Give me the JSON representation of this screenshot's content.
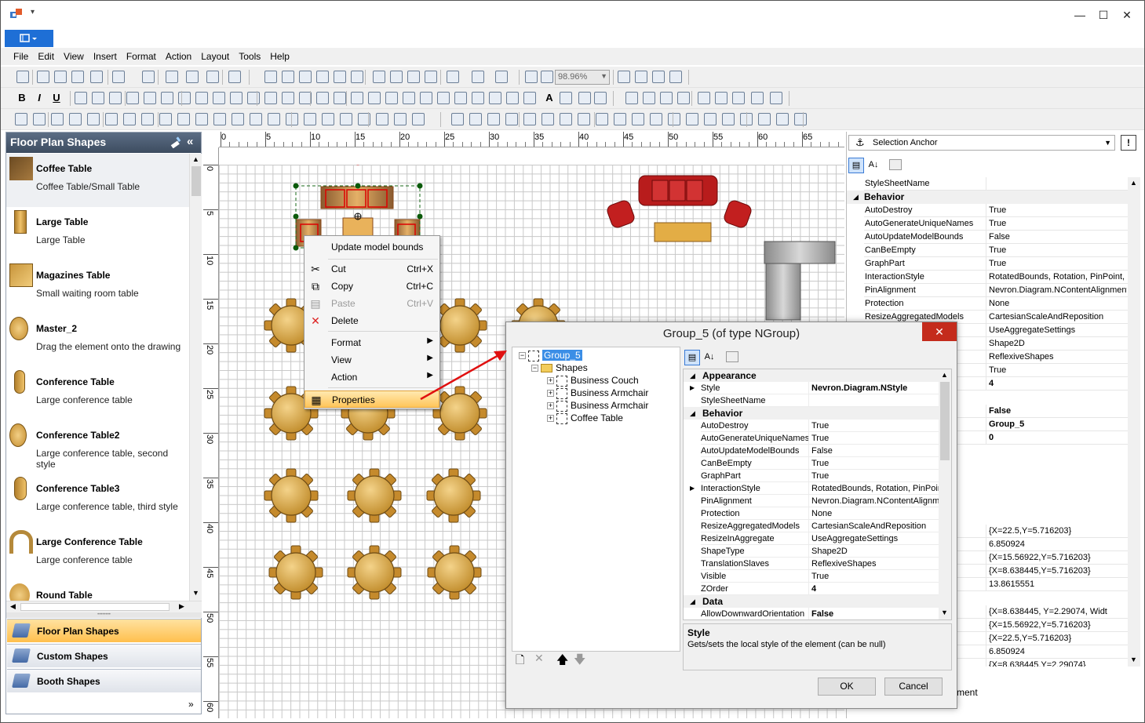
{
  "window": {
    "quick_access_glyph": "▾",
    "minimize": "—",
    "maximize": "☐",
    "close": "✕"
  },
  "menu": {
    "items": [
      "File",
      "Edit",
      "View",
      "Insert",
      "Format",
      "Action",
      "Layout",
      "Tools",
      "Help"
    ]
  },
  "toolbar": {
    "zoom": "98.96%"
  },
  "library": {
    "title": "Floor Plan Shapes",
    "items": [
      {
        "title": "Coffee Table",
        "desc": "Coffee Table/Small Table"
      },
      {
        "title": "Large Table",
        "desc": "Large Table"
      },
      {
        "title": "Magazines Table",
        "desc": "Small waiting room table"
      },
      {
        "title": "Master_2",
        "desc": "Drag the element onto the drawing"
      },
      {
        "title": "Conference Table",
        "desc": "Large conference table"
      },
      {
        "title": "Conference Table2",
        "desc": "Large conference table, second style"
      },
      {
        "title": "Conference Table3",
        "desc": "Large conference table, third style"
      },
      {
        "title": "Large Conference Table",
        "desc": "Large conference table"
      },
      {
        "title": "Round Table",
        "desc": ""
      }
    ],
    "nav": [
      "Floor Plan Shapes",
      "Custom Shapes",
      "Booth Shapes"
    ]
  },
  "rulers": {
    "h": [
      "0",
      "5",
      "10",
      "15",
      "20",
      "25",
      "30",
      "35",
      "40",
      "45",
      "50",
      "55",
      "60",
      "65"
    ],
    "v": [
      "0",
      "5",
      "10",
      "15",
      "20",
      "25",
      "30",
      "35",
      "40",
      "45",
      "50",
      "55",
      "60"
    ]
  },
  "context_menu": {
    "items": [
      {
        "label": "Update model bounds",
        "shortcut": ""
      },
      {
        "label": "Cut",
        "shortcut": "Ctrl+X"
      },
      {
        "label": "Copy",
        "shortcut": "Ctrl+C"
      },
      {
        "label": "Paste",
        "shortcut": "Ctrl+V"
      },
      {
        "label": "Delete",
        "shortcut": ""
      },
      {
        "label": "Format",
        "shortcut": ""
      },
      {
        "label": "View",
        "shortcut": ""
      },
      {
        "label": "Action",
        "shortcut": ""
      },
      {
        "label": "Properties",
        "shortcut": ""
      }
    ]
  },
  "properties": {
    "selector": "Selection Anchor",
    "rows": [
      {
        "n": "StyleSheetName",
        "v": "",
        "cat": false
      },
      {
        "n": "Behavior",
        "v": "",
        "cat": true
      },
      {
        "n": "AutoDestroy",
        "v": "True"
      },
      {
        "n": "AutoGenerateUniqueNames",
        "v": "True"
      },
      {
        "n": "AutoUpdateModelBounds",
        "v": "False"
      },
      {
        "n": "CanBeEmpty",
        "v": "True"
      },
      {
        "n": "GraphPart",
        "v": "True"
      },
      {
        "n": "InteractionStyle",
        "v": "RotatedBounds, Rotation, PinPoint, S"
      },
      {
        "n": "PinAlignment",
        "v": "Nevron.Diagram.NContentAlignment"
      },
      {
        "n": "Protection",
        "v": "None"
      },
      {
        "n": "ResizeAggregatedModels",
        "v": "CartesianScaleAndReposition"
      },
      {
        "n": "",
        "v": "UseAggregateSettings"
      },
      {
        "n": "",
        "v": "Shape2D"
      },
      {
        "n": "",
        "v": "ReflexiveShapes"
      },
      {
        "n": "",
        "v": "True"
      },
      {
        "n": "",
        "v": "4",
        "b": true
      }
    ],
    "rows2": [
      {
        "n": "on",
        "v": "False",
        "b": true
      },
      {
        "n": "",
        "v": "Group_5",
        "b": true
      },
      {
        "n": "",
        "v": "0",
        "b": true
      }
    ],
    "rows3": [
      {
        "v": "{X=22.5,Y=5.716203}"
      },
      {
        "v": "6.850924"
      },
      {
        "v": "{X=15.56922,Y=5.716203}"
      },
      {
        "v": "{X=8.638445,Y=5.716203}"
      },
      {
        "v": "13.8615551"
      }
    ],
    "rows4": [
      {
        "v": "{X=8.638445, Y=2.29074, Widt"
      },
      {
        "v": "{X=15.56922,Y=5.716203}"
      },
      {
        "v": "{X=22.5,Y=5.716203}"
      },
      {
        "v": "6.850924"
      },
      {
        "v": "{X=8.638445,Y=2.29074}"
      }
    ],
    "footer_fragment": "ment"
  },
  "dialog": {
    "title": "Group_5 (of type NGroup)",
    "close": "✕",
    "tree": {
      "root": "Group_5",
      "folder": "Shapes",
      "children": [
        "Business Couch",
        "Business Armchair",
        "Business Armchair",
        "Coffee Table"
      ]
    },
    "grid": [
      {
        "n": "Appearance",
        "cat": true
      },
      {
        "n": "Style",
        "v": "Nevron.Diagram.NStyle",
        "b": true,
        "exp": true
      },
      {
        "n": "StyleSheetName",
        "v": ""
      },
      {
        "n": "Behavior",
        "cat": true
      },
      {
        "n": "AutoDestroy",
        "v": "True"
      },
      {
        "n": "AutoGenerateUniqueNames",
        "v": "True"
      },
      {
        "n": "AutoUpdateModelBounds",
        "v": "False"
      },
      {
        "n": "CanBeEmpty",
        "v": "True"
      },
      {
        "n": "GraphPart",
        "v": "True"
      },
      {
        "n": "InteractionStyle",
        "v": "RotatedBounds, Rotation, PinPoint",
        "exp": true
      },
      {
        "n": "PinAlignment",
        "v": "Nevron.Diagram.NContentAlignment"
      },
      {
        "n": "Protection",
        "v": "None"
      },
      {
        "n": "ResizeAggregatedModels",
        "v": "CartesianScaleAndReposition"
      },
      {
        "n": "ResizeInAggregate",
        "v": "UseAggregateSettings"
      },
      {
        "n": "ShapeType",
        "v": "Shape2D"
      },
      {
        "n": "TranslationSlaves",
        "v": "ReflexiveShapes"
      },
      {
        "n": "Visible",
        "v": "True"
      },
      {
        "n": "ZOrder",
        "v": "4",
        "b": true
      },
      {
        "n": "Data",
        "cat": true
      },
      {
        "n": "AllowDownwardOrientation",
        "v": "False",
        "b": true
      }
    ],
    "desc_title": "Style",
    "desc_text": "Gets/sets the local style of the element (can be null)",
    "ok": "OK",
    "cancel": "Cancel"
  },
  "colors": {
    "accent": "#1e6fd6",
    "panel_head": "#4a5a70",
    "nav_active": "#ffc45a",
    "close_red": "#c42b1c",
    "table_gold": "#d9a441",
    "couch_red": "#b81c1c"
  }
}
